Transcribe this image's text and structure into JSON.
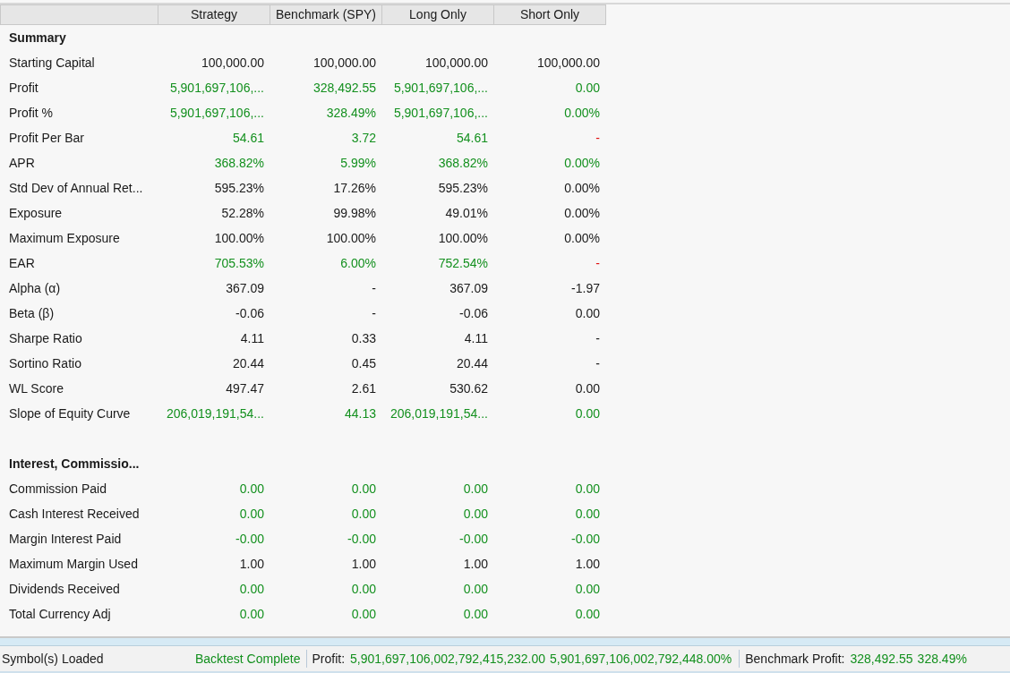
{
  "table": {
    "columns": [
      "Strategy",
      "Benchmark (SPY)",
      "Long Only",
      "Short Only"
    ],
    "sections": [
      {
        "title": "Summary",
        "rows": [
          {
            "label": "Starting Capital",
            "cells": [
              {
                "text": "100,000.00",
                "color": "#1a1a1a"
              },
              {
                "text": "100,000.00",
                "color": "#1a1a1a"
              },
              {
                "text": "100,000.00",
                "color": "#1a1a1a"
              },
              {
                "text": "100,000.00",
                "color": "#1a1a1a"
              }
            ]
          },
          {
            "label": "Profit",
            "cells": [
              {
                "text": "5,901,697,106,...",
                "color": "#13901e"
              },
              {
                "text": "328,492.55",
                "color": "#13901e"
              },
              {
                "text": "5,901,697,106,...",
                "color": "#13901e"
              },
              {
                "text": "0.00",
                "color": "#13901e"
              }
            ]
          },
          {
            "label": "Profit %",
            "cells": [
              {
                "text": "5,901,697,106,...",
                "color": "#13901e"
              },
              {
                "text": "328.49%",
                "color": "#13901e"
              },
              {
                "text": "5,901,697,106,...",
                "color": "#13901e"
              },
              {
                "text": "0.00%",
                "color": "#13901e"
              }
            ]
          },
          {
            "label": "Profit Per Bar",
            "cells": [
              {
                "text": "54.61",
                "color": "#13901e"
              },
              {
                "text": "3.72",
                "color": "#13901e"
              },
              {
                "text": "54.61",
                "color": "#13901e"
              },
              {
                "text": "-",
                "color": "#e01010"
              }
            ]
          },
          {
            "label": "APR",
            "cells": [
              {
                "text": "368.82%",
                "color": "#13901e"
              },
              {
                "text": "5.99%",
                "color": "#13901e"
              },
              {
                "text": "368.82%",
                "color": "#13901e"
              },
              {
                "text": "0.00%",
                "color": "#13901e"
              }
            ]
          },
          {
            "label": "Std Dev of Annual Ret...",
            "cells": [
              {
                "text": "595.23%",
                "color": "#1a1a1a"
              },
              {
                "text": "17.26%",
                "color": "#1a1a1a"
              },
              {
                "text": "595.23%",
                "color": "#1a1a1a"
              },
              {
                "text": "0.00%",
                "color": "#1a1a1a"
              }
            ]
          },
          {
            "label": "Exposure",
            "cells": [
              {
                "text": "52.28%",
                "color": "#1a1a1a"
              },
              {
                "text": "99.98%",
                "color": "#1a1a1a"
              },
              {
                "text": "49.01%",
                "color": "#1a1a1a"
              },
              {
                "text": "0.00%",
                "color": "#1a1a1a"
              }
            ]
          },
          {
            "label": "Maximum Exposure",
            "cells": [
              {
                "text": "100.00%",
                "color": "#1a1a1a"
              },
              {
                "text": "100.00%",
                "color": "#1a1a1a"
              },
              {
                "text": "100.00%",
                "color": "#1a1a1a"
              },
              {
                "text": "0.00%",
                "color": "#1a1a1a"
              }
            ]
          },
          {
            "label": "EAR",
            "cells": [
              {
                "text": "705.53%",
                "color": "#13901e"
              },
              {
                "text": "6.00%",
                "color": "#13901e"
              },
              {
                "text": "752.54%",
                "color": "#13901e"
              },
              {
                "text": "-",
                "color": "#e01010"
              }
            ]
          },
          {
            "label": "Alpha (α)",
            "cells": [
              {
                "text": "367.09",
                "color": "#1a1a1a"
              },
              {
                "text": "-",
                "color": "#1a1a1a"
              },
              {
                "text": "367.09",
                "color": "#1a1a1a"
              },
              {
                "text": "-1.97",
                "color": "#1a1a1a"
              }
            ]
          },
          {
            "label": "Beta (β)",
            "cells": [
              {
                "text": "-0.06",
                "color": "#1a1a1a"
              },
              {
                "text": "-",
                "color": "#1a1a1a"
              },
              {
                "text": "-0.06",
                "color": "#1a1a1a"
              },
              {
                "text": "0.00",
                "color": "#1a1a1a"
              }
            ]
          },
          {
            "label": "Sharpe Ratio",
            "cells": [
              {
                "text": "4.11",
                "color": "#1a1a1a"
              },
              {
                "text": "0.33",
                "color": "#1a1a1a"
              },
              {
                "text": "4.11",
                "color": "#1a1a1a"
              },
              {
                "text": "-",
                "color": "#1a1a1a"
              }
            ]
          },
          {
            "label": "Sortino Ratio",
            "cells": [
              {
                "text": "20.44",
                "color": "#1a1a1a"
              },
              {
                "text": "0.45",
                "color": "#1a1a1a"
              },
              {
                "text": "20.44",
                "color": "#1a1a1a"
              },
              {
                "text": "-",
                "color": "#1a1a1a"
              }
            ]
          },
          {
            "label": "WL Score",
            "cells": [
              {
                "text": "497.47",
                "color": "#1a1a1a"
              },
              {
                "text": "2.61",
                "color": "#1a1a1a"
              },
              {
                "text": "530.62",
                "color": "#1a1a1a"
              },
              {
                "text": "0.00",
                "color": "#1a1a1a"
              }
            ]
          },
          {
            "label": "Slope of Equity Curve",
            "cells": [
              {
                "text": "206,019,191,54...",
                "color": "#13901e"
              },
              {
                "text": "44.13",
                "color": "#13901e"
              },
              {
                "text": "206,019,191,54...",
                "color": "#13901e"
              },
              {
                "text": "0.00",
                "color": "#13901e"
              }
            ]
          }
        ]
      },
      {
        "title": "Interest, Commissio...",
        "rows": [
          {
            "label": "Commission Paid",
            "cells": [
              {
                "text": "0.00",
                "color": "#13901e"
              },
              {
                "text": "0.00",
                "color": "#13901e"
              },
              {
                "text": "0.00",
                "color": "#13901e"
              },
              {
                "text": "0.00",
                "color": "#13901e"
              }
            ]
          },
          {
            "label": "Cash Interest Received",
            "cells": [
              {
                "text": "0.00",
                "color": "#13901e"
              },
              {
                "text": "0.00",
                "color": "#13901e"
              },
              {
                "text": "0.00",
                "color": "#13901e"
              },
              {
                "text": "0.00",
                "color": "#13901e"
              }
            ]
          },
          {
            "label": "Margin Interest Paid",
            "cells": [
              {
                "text": "-0.00",
                "color": "#13901e"
              },
              {
                "text": "-0.00",
                "color": "#13901e"
              },
              {
                "text": "-0.00",
                "color": "#13901e"
              },
              {
                "text": "-0.00",
                "color": "#13901e"
              }
            ]
          },
          {
            "label": "Maximum Margin Used",
            "cells": [
              {
                "text": "1.00",
                "color": "#1a1a1a"
              },
              {
                "text": "1.00",
                "color": "#1a1a1a"
              },
              {
                "text": "1.00",
                "color": "#1a1a1a"
              },
              {
                "text": "1.00",
                "color": "#1a1a1a"
              }
            ]
          },
          {
            "label": "Dividends Received",
            "cells": [
              {
                "text": "0.00",
                "color": "#13901e"
              },
              {
                "text": "0.00",
                "color": "#13901e"
              },
              {
                "text": "0.00",
                "color": "#13901e"
              },
              {
                "text": "0.00",
                "color": "#13901e"
              }
            ]
          },
          {
            "label": "Total Currency Adj",
            "cells": [
              {
                "text": "0.00",
                "color": "#13901e"
              },
              {
                "text": "0.00",
                "color": "#13901e"
              },
              {
                "text": "0.00",
                "color": "#13901e"
              },
              {
                "text": "0.00",
                "color": "#13901e"
              }
            ]
          }
        ]
      }
    ]
  },
  "status_bar": {
    "symbols": "Symbol(s) Loaded",
    "backtest": "Backtest Complete",
    "profit_label": "Profit:",
    "profit_value": "5,901,697,106,002,792,415,232.00",
    "profit_percent": "5,901,697,106,002,792,448.00%",
    "benchmark_label": "Benchmark Profit:",
    "benchmark_value": "328,492.55",
    "benchmark_percent": "328.49%"
  }
}
